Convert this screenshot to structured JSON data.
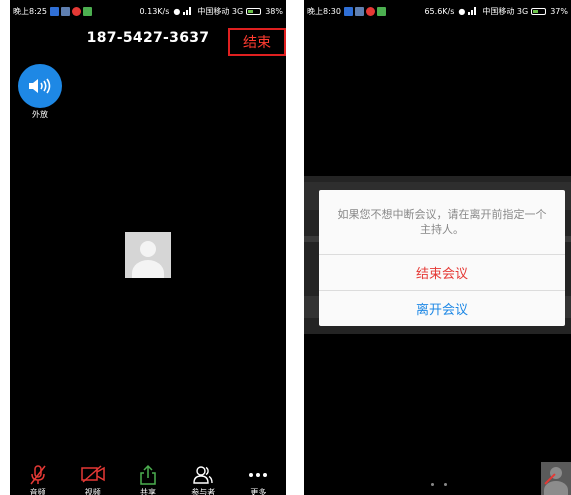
{
  "left_screen": {
    "status_bar": {
      "time": "晚上8:25",
      "network_speed": "0.13K/s",
      "carrier": "中国移动 3G",
      "battery": "38%",
      "battery_level": 0.38
    },
    "call": {
      "number": "187-5427-3637",
      "end_label": "结束"
    },
    "speaker": {
      "label": "外放",
      "icon": "speaker-icon"
    },
    "toolbar": [
      {
        "label": "音频",
        "icon": "mic-muted-icon"
      },
      {
        "label": "视频",
        "icon": "video-off-icon"
      },
      {
        "label": "共享",
        "icon": "share-icon"
      },
      {
        "label": "参与者",
        "icon": "participants-icon"
      },
      {
        "label": "更多",
        "icon": "more-icon"
      }
    ]
  },
  "right_screen": {
    "status_bar": {
      "time": "晚上8:30",
      "network_speed": "65.6K/s",
      "carrier": "中国移动 3G",
      "battery": "37%",
      "battery_level": 0.37
    },
    "dialog": {
      "message": "如果您不想中断会议，请在离开前指定一个主持人。",
      "end_meeting_label": "结束会议",
      "leave_meeting_label": "离开会议"
    }
  },
  "colors": {
    "accent_blue": "#1e88e5",
    "end_red": "#e53935",
    "share_green": "#4caf50"
  }
}
